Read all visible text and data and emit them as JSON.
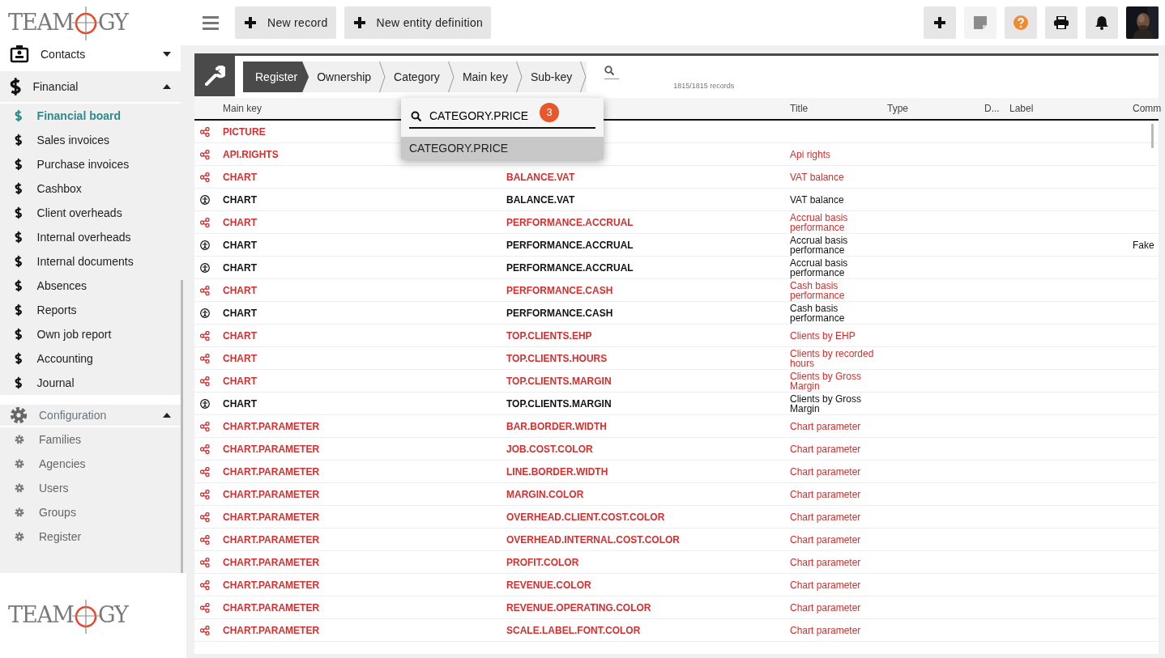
{
  "logos": [
    {
      "left": "TEAM",
      "right": "GY"
    },
    {
      "left": "TEAM",
      "right": "GY"
    }
  ],
  "toolbar": {
    "buttons": [
      {
        "label": "New record"
      },
      {
        "label": "New entity definition"
      }
    ],
    "icon_buttons": [
      {
        "kind": "add",
        "disabled": false
      },
      {
        "kind": "note",
        "disabled": true
      },
      {
        "kind": "help",
        "disabled": false
      },
      {
        "kind": "print",
        "disabled": false
      },
      {
        "kind": "bell",
        "disabled": false
      }
    ]
  },
  "sidebar": {
    "groups": [
      {
        "label": "Contacts",
        "expanded": false
      },
      {
        "label": "Financial",
        "expanded": true,
        "items": [
          {
            "label": "Financial board",
            "selected": true
          },
          {
            "label": "Sales invoices",
            "selected": false
          },
          {
            "label": "Purchase invoices",
            "selected": false
          },
          {
            "label": "Cashbox",
            "selected": false
          },
          {
            "label": "Client overheads",
            "selected": false
          },
          {
            "label": "Internal overheads",
            "selected": false
          },
          {
            "label": "Internal documents",
            "selected": false
          },
          {
            "label": "Absences",
            "selected": false
          },
          {
            "label": "Reports",
            "selected": false
          },
          {
            "label": "Own job report",
            "selected": false
          },
          {
            "label": "Accounting",
            "selected": false
          },
          {
            "label": "Journal",
            "selected": false
          }
        ]
      },
      {
        "label": "Configuration",
        "expanded": true,
        "items": [
          {
            "label": "Families",
            "selected": false
          },
          {
            "label": "Agencies",
            "selected": false
          },
          {
            "label": "Users",
            "selected": false
          },
          {
            "label": "Groups",
            "selected": false
          },
          {
            "label": "Register",
            "selected": false
          }
        ]
      }
    ]
  },
  "breadcrumb": [
    {
      "label": "Register",
      "selected": true
    },
    {
      "label": "Ownership",
      "selected": false
    },
    {
      "label": "Category",
      "selected": false
    },
    {
      "label": "Main key",
      "selected": false
    },
    {
      "label": "Sub-key",
      "selected": false
    }
  ],
  "records_count": "1815/1815 records",
  "dropdown": {
    "value": "CATEGORY.PRICE",
    "badge": "3",
    "options": [
      {
        "label": "CATEGORY.PRICE",
        "selected": true
      }
    ]
  },
  "table": {
    "columns": [
      {
        "label": "Main key"
      },
      {
        "label": "Title"
      },
      {
        "label": "Type"
      },
      {
        "label": "D..."
      },
      {
        "label": "Label"
      },
      {
        "label": "Comm"
      }
    ],
    "rows": [
      {
        "kind": "shared",
        "main_key": "PICTURE"
      },
      {
        "kind": "shared",
        "main_key": "API.RIGHTS",
        "title": "Api rights"
      },
      {
        "kind": "shared",
        "main_key": "CHART",
        "sub_key": "BALANCE.VAT",
        "title": "VAT balance"
      },
      {
        "kind": "own",
        "main_key": "CHART",
        "sub_key": "BALANCE.VAT",
        "title": "VAT balance"
      },
      {
        "kind": "shared",
        "main_key": "CHART",
        "sub_key": "PERFORMANCE.ACCRUAL",
        "title": "Accrual basis performance"
      },
      {
        "kind": "own",
        "main_key": "CHART",
        "sub_key": "PERFORMANCE.ACCRUAL",
        "title": "Accrual basis performance",
        "comment": "Fake"
      },
      {
        "kind": "own",
        "main_key": "CHART",
        "sub_key": "PERFORMANCE.ACCRUAL",
        "title": "Accrual basis performance"
      },
      {
        "kind": "shared",
        "main_key": "CHART",
        "sub_key": "PERFORMANCE.CASH",
        "title": "Cash basis performance"
      },
      {
        "kind": "own",
        "main_key": "CHART",
        "sub_key": "PERFORMANCE.CASH",
        "title": "Cash basis performance"
      },
      {
        "kind": "shared",
        "main_key": "CHART",
        "sub_key": "TOP.CLIENTS.EHP",
        "title": "Clients by EHP"
      },
      {
        "kind": "shared",
        "main_key": "CHART",
        "sub_key": "TOP.CLIENTS.HOURS",
        "title": "Clients by recorded hours"
      },
      {
        "kind": "shared",
        "main_key": "CHART",
        "sub_key": "TOP.CLIENTS.MARGIN",
        "title": "Clients by Gross Margin"
      },
      {
        "kind": "own",
        "main_key": "CHART",
        "sub_key": "TOP.CLIENTS.MARGIN",
        "title": "Clients by Gross Margin"
      },
      {
        "kind": "shared",
        "main_key": "CHART.PARAMETER",
        "sub_key": "BAR.BORDER.WIDTH",
        "title": "Chart parameter"
      },
      {
        "kind": "shared",
        "main_key": "CHART.PARAMETER",
        "sub_key": "JOB.COST.COLOR",
        "title": "Chart parameter"
      },
      {
        "kind": "shared",
        "main_key": "CHART.PARAMETER",
        "sub_key": "LINE.BORDER.WIDTH",
        "title": "Chart parameter"
      },
      {
        "kind": "shared",
        "main_key": "CHART.PARAMETER",
        "sub_key": "MARGIN.COLOR",
        "title": "Chart parameter"
      },
      {
        "kind": "shared",
        "main_key": "CHART.PARAMETER",
        "sub_key": "OVERHEAD.CLIENT.COST.COLOR",
        "title": "Chart parameter"
      },
      {
        "kind": "shared",
        "main_key": "CHART.PARAMETER",
        "sub_key": "OVERHEAD.INTERNAL.COST.COLOR",
        "title": "Chart parameter"
      },
      {
        "kind": "shared",
        "main_key": "CHART.PARAMETER",
        "sub_key": "PROFIT.COLOR",
        "title": "Chart parameter"
      },
      {
        "kind": "shared",
        "main_key": "CHART.PARAMETER",
        "sub_key": "REVENUE.COLOR",
        "title": "Chart parameter"
      },
      {
        "kind": "shared",
        "main_key": "CHART.PARAMETER",
        "sub_key": "REVENUE.OPERATING.COLOR",
        "title": "Chart parameter"
      },
      {
        "kind": "shared",
        "main_key": "CHART.PARAMETER",
        "sub_key": "SCALE.LABEL.FONT.COLOR",
        "title": "Chart parameter"
      }
    ]
  }
}
